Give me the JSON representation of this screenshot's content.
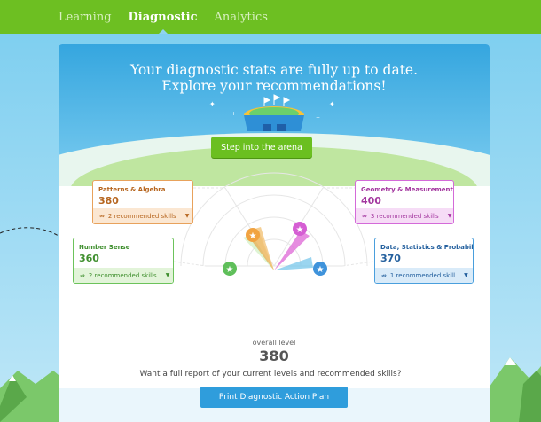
{
  "nav": {
    "tabs": [
      {
        "label": "Learning"
      },
      {
        "label": "Diagnostic"
      },
      {
        "label": "Analytics"
      }
    ],
    "active": "Diagnostic"
  },
  "hero": {
    "title_line1": "Your diagnostic stats are fully up to date.",
    "title_line2": "Explore your recommendations!",
    "arena_button": "Step into the arena"
  },
  "stats": {
    "patterns_algebra": {
      "name": "Patterns & Algebra",
      "value": "380",
      "recommended": "2 recommended skills",
      "color": "#e8a25c"
    },
    "geometry_measurement": {
      "name": "Geometry & Measurement",
      "value": "400",
      "recommended": "3 recommended skills",
      "color": "#d46ad9"
    },
    "number_sense": {
      "name": "Number Sense",
      "value": "360",
      "recommended": "2 recommended skills",
      "color": "#6cc35b"
    },
    "data_statistics": {
      "name": "Data, Statistics & Probability",
      "value": "370",
      "recommended": "1 recommended skill",
      "color": "#4a9fdd"
    }
  },
  "overall": {
    "label": "overall level",
    "value": "380"
  },
  "footer": {
    "prompt": "Want a full report of your current levels and recommended skills?",
    "print_button": "Print Diagnostic Action Plan"
  },
  "icons": {
    "skill_icon": "skill-icon",
    "dropdown": "caret-down-icon",
    "star": "star-icon"
  }
}
